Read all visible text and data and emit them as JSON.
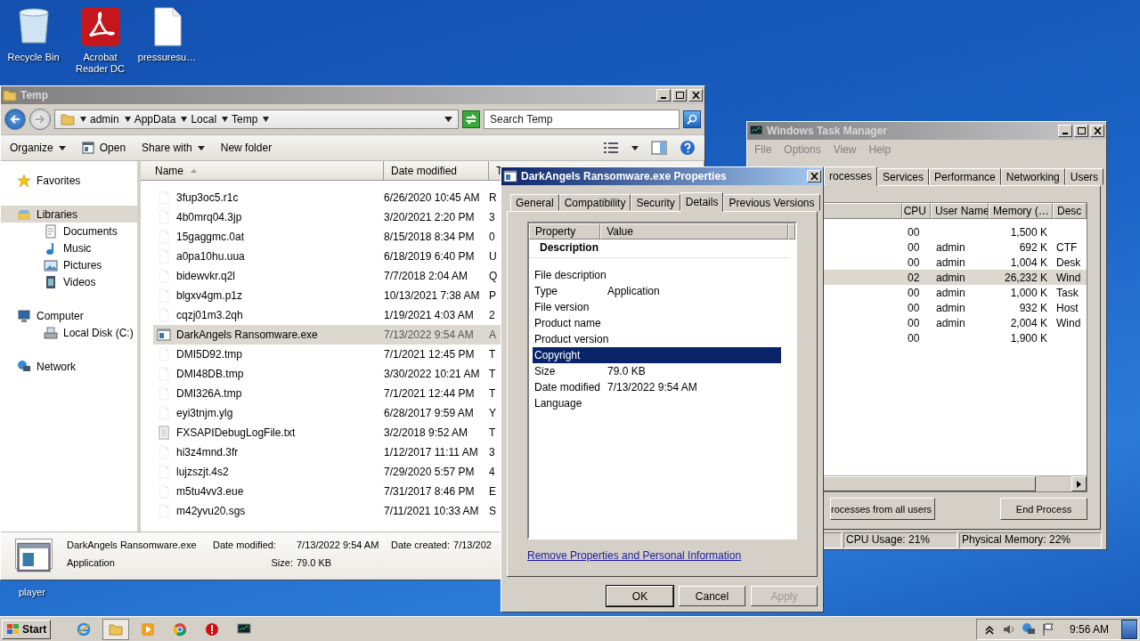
{
  "desktop_icons": [
    {
      "label": "Recycle Bin",
      "kind": "bin"
    },
    {
      "label": "Acrobat Reader DC",
      "kind": "pdf"
    },
    {
      "label": "pressuresu…",
      "kind": "file"
    }
  ],
  "desktop_partial_label": "player",
  "explorer": {
    "title": "Temp",
    "active": false,
    "breadcrumb": [
      "admin",
      "AppData",
      "Local",
      "Temp"
    ],
    "search": {
      "placeholder": "Search Temp"
    },
    "toolbar": [
      {
        "label": "Organize",
        "kind": "menu"
      },
      {
        "label": "Open",
        "kind": "open"
      },
      {
        "label": "Share with",
        "kind": "menu"
      },
      {
        "label": "New folder",
        "kind": "plain"
      }
    ],
    "nav": [
      {
        "label": "Favorites",
        "kind": "star",
        "selected": false
      },
      {
        "label": "Libraries",
        "kind": "library",
        "selected": true,
        "children": [
          {
            "label": "Documents",
            "kind": "doc",
            "selected": false
          },
          {
            "label": "Music",
            "kind": "music",
            "selected": false
          },
          {
            "label": "Pictures",
            "kind": "picture",
            "selected": false
          },
          {
            "label": "Videos",
            "kind": "video",
            "selected": false
          }
        ]
      },
      {
        "label": "Computer",
        "kind": "computer",
        "selected": false,
        "children": [
          {
            "label": "Local Disk (C:)",
            "kind": "disk",
            "selected": false
          }
        ]
      },
      {
        "label": "Network",
        "kind": "network",
        "selected": false
      }
    ],
    "columns": [
      "Name",
      "Date modified",
      "T"
    ],
    "files": [
      {
        "name": "3fup3oc5.r1c",
        "date": "6/26/2020 10:45 AM",
        "column_3": "R",
        "kind": "file",
        "selected": false
      },
      {
        "name": "4b0mrq04.3jp",
        "date": "3/20/2021 2:20 PM",
        "column_3": "3",
        "kind": "file",
        "selected": false
      },
      {
        "name": "15gaggmc.0at",
        "date": "8/15/2018 8:34 PM",
        "column_3": "0",
        "kind": "file",
        "selected": false
      },
      {
        "name": "a0pa10hu.uua",
        "date": "6/18/2019 6:40 PM",
        "column_3": "U",
        "kind": "file",
        "selected": false
      },
      {
        "name": "bidewvkr.q2l",
        "date": "7/7/2018 2:04 AM",
        "column_3": "Q",
        "kind": "file",
        "selected": false
      },
      {
        "name": "blgxv4gm.p1z",
        "date": "10/13/2021 7:38 AM",
        "column_3": "P",
        "kind": "file",
        "selected": false
      },
      {
        "name": "cqzj01m3.2qh",
        "date": "1/19/2021 4:03 AM",
        "column_3": "2",
        "kind": "file",
        "selected": false
      },
      {
        "name": "DarkAngels Ransomware.exe",
        "date": "7/13/2022 9:54 AM",
        "column_3": "A",
        "kind": "exe",
        "selected": true
      },
      {
        "name": "DMI5D92.tmp",
        "date": "7/1/2021 12:45 PM",
        "column_3": "T",
        "kind": "file",
        "selected": false
      },
      {
        "name": "DMI48DB.tmp",
        "date": "3/30/2022 10:21 AM",
        "column_3": "T",
        "kind": "file",
        "selected": false
      },
      {
        "name": "DMI326A.tmp",
        "date": "7/1/2021 12:44 PM",
        "column_3": "T",
        "kind": "file",
        "selected": false
      },
      {
        "name": "eyi3tnjm.ylg",
        "date": "6/28/2017 9:59 AM",
        "column_3": "Y",
        "kind": "file",
        "selected": false
      },
      {
        "name": "FXSAPIDebugLogFile.txt",
        "date": "3/2/2018 9:52 AM",
        "column_3": "T",
        "kind": "text",
        "selected": false
      },
      {
        "name": "hi3z4mnd.3fr",
        "date": "1/12/2017 11:11 AM",
        "column_3": "3",
        "kind": "file",
        "selected": false
      },
      {
        "name": "lujzszjt.4s2",
        "date": "7/29/2020 5:57 PM",
        "column_3": "4",
        "kind": "file",
        "selected": false
      },
      {
        "name": "m5tu4vv3.eue",
        "date": "7/31/2017 8:46 PM",
        "column_3": "E",
        "kind": "file",
        "selected": false
      },
      {
        "name": "m42yvu20.sgs",
        "date": "7/11/2021 10:33 AM",
        "column_3": "S",
        "kind": "file",
        "selected": false
      }
    ],
    "details": {
      "name": "DarkAngels Ransomware.exe",
      "type": "Application",
      "date_modified_label": "Date modified:",
      "date_modified": "7/13/2022 9:54 AM",
      "size_label": "Size:",
      "size": "79.0 KB",
      "date_created_label": "Date created:",
      "date_created": "7/13/202"
    }
  },
  "properties": {
    "title": "DarkAngels Ransomware.exe Properties",
    "active": true,
    "tabs": [
      {
        "label": "General",
        "selected": false
      },
      {
        "label": "Compatibility",
        "selected": false
      },
      {
        "label": "Security",
        "selected": false
      },
      {
        "label": "Details",
        "selected": true
      },
      {
        "label": "Previous Versions",
        "selected": false
      }
    ],
    "columns": [
      "Property",
      "Value"
    ],
    "group": "Description",
    "rows": [
      {
        "property": "File description",
        "selected": false
      },
      {
        "property": "Type",
        "value": "Application",
        "selected": false
      },
      {
        "property": "File version",
        "selected": false
      },
      {
        "property": "Product name",
        "selected": false
      },
      {
        "property": "Product version",
        "selected": false
      },
      {
        "property": "Copyright",
        "selected": true
      },
      {
        "property": "Size",
        "value": "79.0 KB",
        "selected": false
      },
      {
        "property": "Date modified",
        "value": "7/13/2022 9:54 AM",
        "selected": false
      },
      {
        "property": "Language",
        "selected": false
      }
    ],
    "link": "Remove Properties and Personal Information",
    "buttons": [
      {
        "label": "OK",
        "default": true,
        "disabled": false
      },
      {
        "label": "Cancel",
        "default": false,
        "disabled": false
      },
      {
        "label": "Apply",
        "default": false,
        "disabled": true
      }
    ]
  },
  "task_manager": {
    "title": "Windows Task Manager",
    "active": false,
    "menu": [
      "File",
      "Options",
      "View",
      "Help"
    ],
    "tabs": [
      {
        "label": "rocesses",
        "selected": true
      },
      {
        "label": "Services",
        "selected": false
      },
      {
        "label": "Performance",
        "selected": false
      },
      {
        "label": "Networking",
        "selected": false
      },
      {
        "label": "Users",
        "selected": false
      }
    ],
    "columns": [
      "CPU",
      "User Name",
      "Memory (…",
      "Desc"
    ],
    "rows": [
      {
        "cpu": "00",
        "memory": "1,500 K",
        "selected": false
      },
      {
        "cpu": "00",
        "user": "admin",
        "memory": "692 K",
        "column_4": "CTF",
        "selected": false
      },
      {
        "cpu": "00",
        "user": "admin",
        "memory": "1,004 K",
        "column_4": "Desk",
        "selected": false
      },
      {
        "cpu": "02",
        "user": "admin",
        "memory": "26,232 K",
        "column_4": "Wind",
        "selected": true
      },
      {
        "cpu": "00",
        "user": "admin",
        "memory": "1,000 K",
        "column_4": "Task",
        "selected": false
      },
      {
        "cpu": "00",
        "user": "admin",
        "memory": "932 K",
        "column_4": "Host",
        "selected": false
      },
      {
        "cpu": "00",
        "user": "admin",
        "memory": "2,004 K",
        "column_4": "Wind",
        "selected": false
      },
      {
        "cpu": "00",
        "memory": "1,900 K",
        "selected": false
      }
    ],
    "show_all_button": "rocesses from all users",
    "end_button": "End Process",
    "status": [
      "CPU Usage: 21%",
      "Physical Memory: 22%"
    ]
  },
  "taskbar": {
    "start": "Start",
    "apps": [
      {
        "kind": "browser",
        "active": false
      },
      {
        "kind": "folder",
        "active": true
      },
      {
        "kind": "media",
        "active": false
      },
      {
        "kind": "chrome",
        "active": false
      },
      {
        "kind": "stop",
        "active": false
      },
      {
        "kind": "monitor",
        "active": false
      }
    ],
    "clock": "9:56 AM"
  }
}
